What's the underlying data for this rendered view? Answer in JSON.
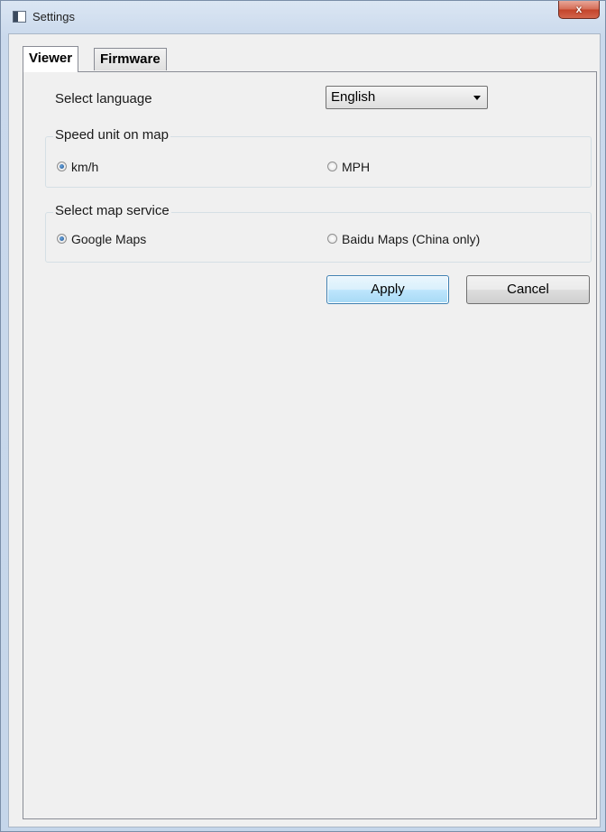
{
  "window": {
    "title": "Settings",
    "close_label": "x"
  },
  "tabs": [
    {
      "label": "Viewer",
      "active": true
    },
    {
      "label": "Firmware",
      "active": false
    }
  ],
  "viewer": {
    "language": {
      "label": "Select language",
      "selected": "English"
    },
    "speed_unit": {
      "title": "Speed unit on map",
      "options": [
        {
          "label": "km/h",
          "checked": true
        },
        {
          "label": "MPH",
          "checked": false
        }
      ]
    },
    "map_service": {
      "title": "Select map service",
      "options": [
        {
          "label": "Google Maps",
          "checked": true
        },
        {
          "label": "Baidu Maps (China only)",
          "checked": false
        }
      ]
    },
    "buttons": {
      "apply": "Apply",
      "cancel": "Cancel"
    }
  },
  "icons": {
    "app": "window-icon",
    "close": "close-icon",
    "dropdown": "chevron-down-icon"
  },
  "colors": {
    "panel_background": "#f0f0f0",
    "default_button": "#bee6fd",
    "close_button": "#c3432a"
  }
}
